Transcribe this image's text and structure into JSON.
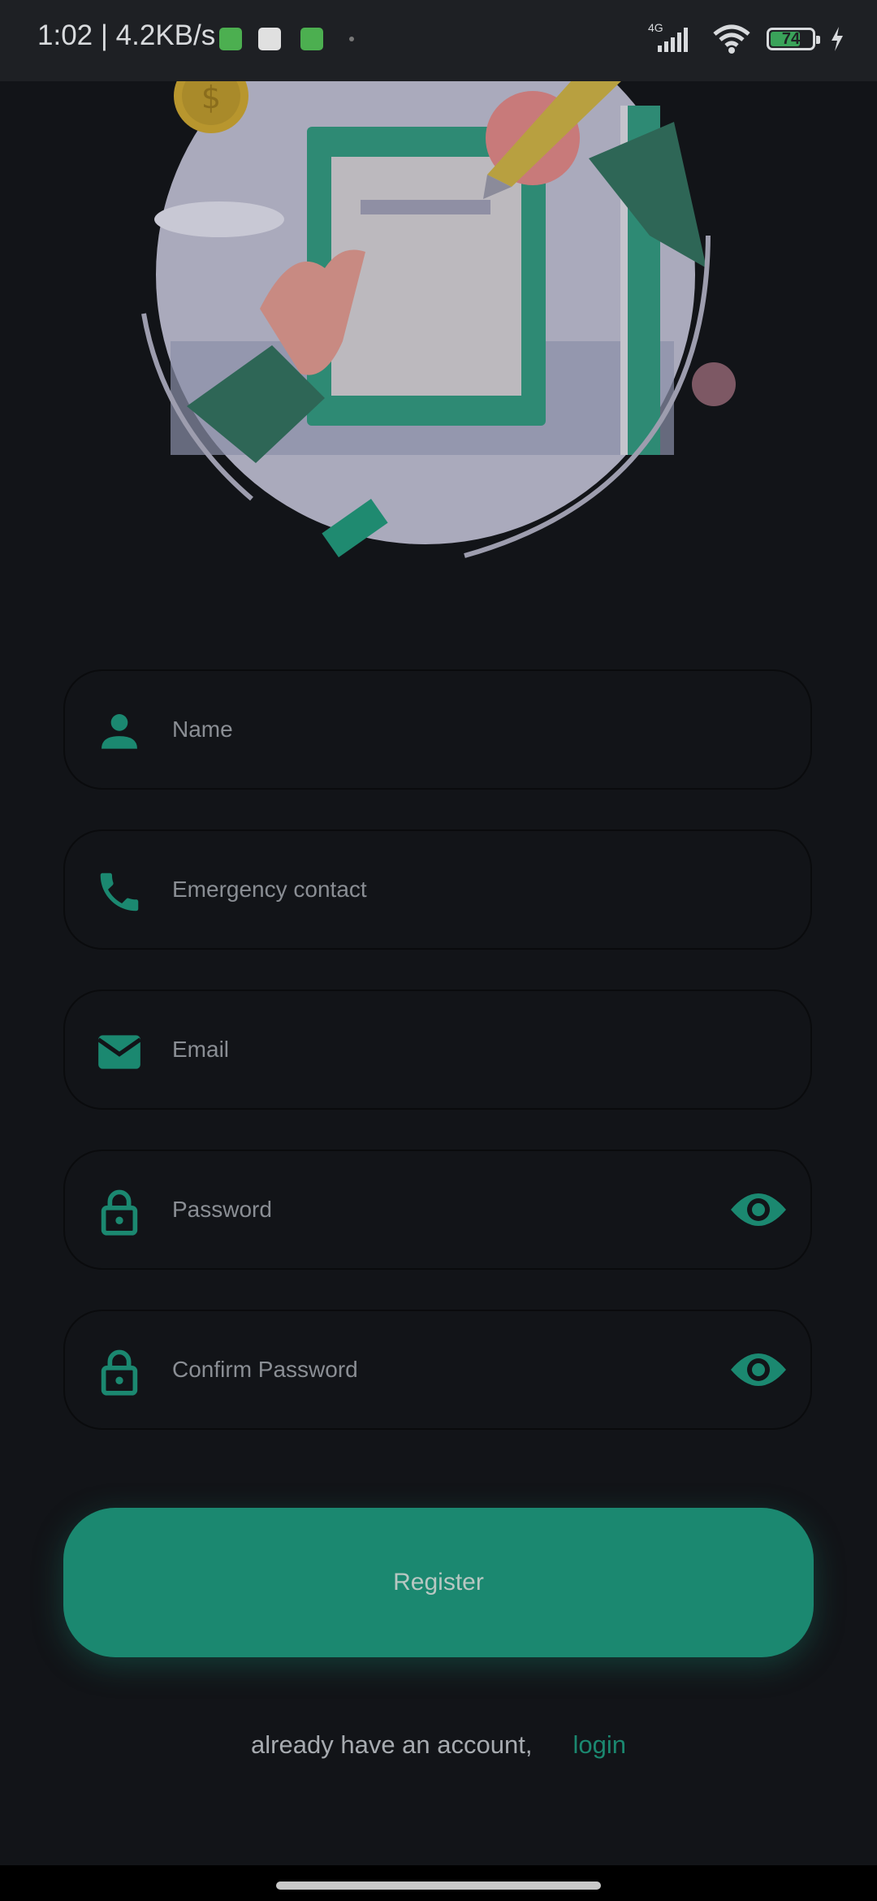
{
  "status_bar": {
    "time_speed": "1:02 | 4.2KB/s",
    "network": "4G",
    "battery": "74",
    "battery_level": 0.74
  },
  "illustration": {
    "icons": [
      "coin-icon",
      "pen-icon",
      "document-icon",
      "hand-icon"
    ]
  },
  "form": {
    "name_placeholder": "Name",
    "emergency_placeholder": "Emergency contact",
    "email_placeholder": "Email",
    "password_placeholder": "Password",
    "confirm_placeholder": "Confirm Password"
  },
  "register_label": "Register",
  "footer": {
    "prompt": "already have an account,",
    "login_label": "login"
  },
  "colors": {
    "accent": "#1b8870",
    "background": "#121418",
    "field_border": "#0a0b0d"
  }
}
